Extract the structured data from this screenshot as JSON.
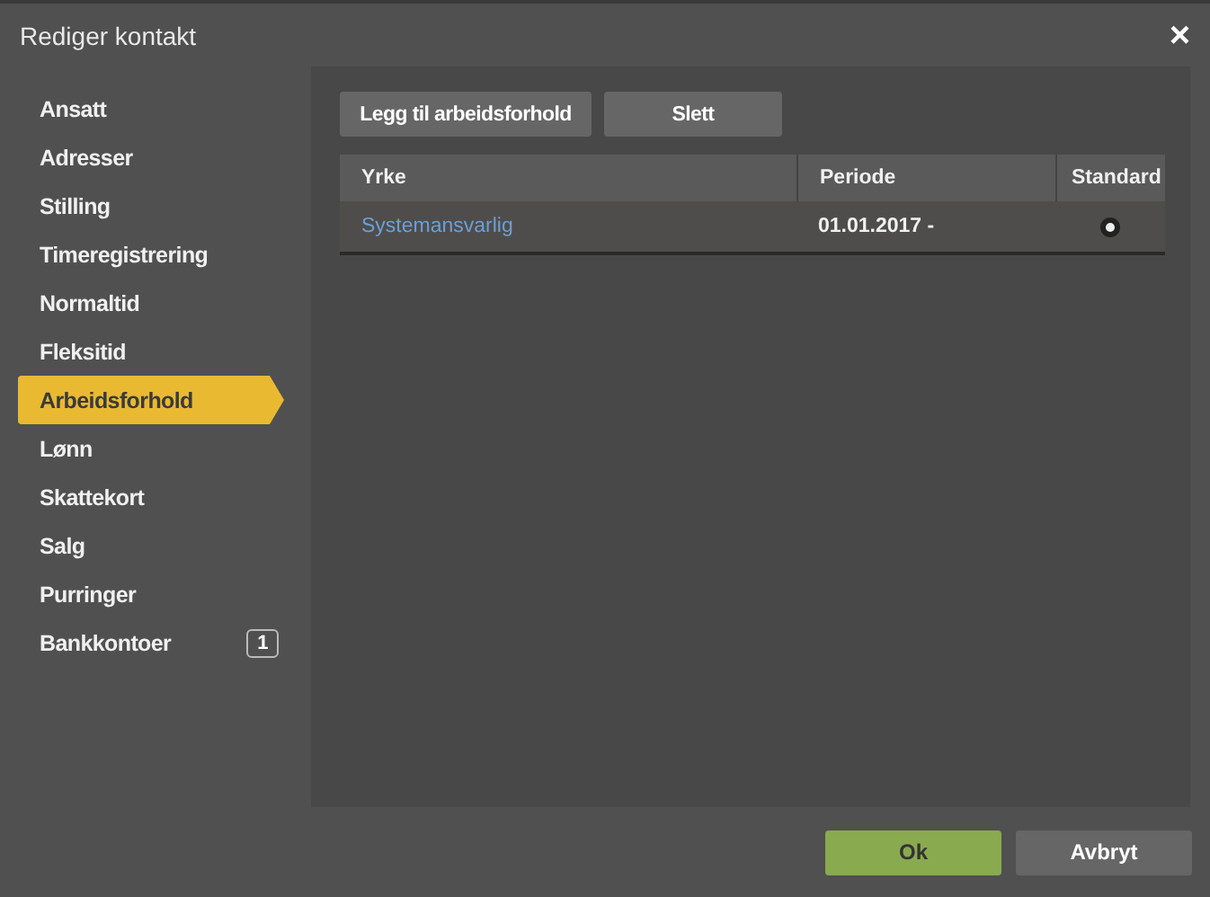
{
  "window": {
    "title": "Rediger kontakt",
    "close": "×"
  },
  "sidebar": {
    "items": [
      {
        "label": "Ansatt",
        "selected": false
      },
      {
        "label": "Adresser",
        "selected": false
      },
      {
        "label": "Stilling",
        "selected": false
      },
      {
        "label": "Timeregistrering",
        "selected": false
      },
      {
        "label": "Normaltid",
        "selected": false
      },
      {
        "label": "Fleksitid",
        "selected": false
      },
      {
        "label": "Arbeidsforhold",
        "selected": true
      },
      {
        "label": "Lønn",
        "selected": false
      },
      {
        "label": "Skattekort",
        "selected": false
      },
      {
        "label": "Salg",
        "selected": false
      },
      {
        "label": "Purringer",
        "selected": false
      },
      {
        "label": "Bankkontoer",
        "selected": false,
        "badge": "1"
      }
    ]
  },
  "toolbar": [
    "Legg til arbeidsforhold",
    "Slett"
  ],
  "table": {
    "columns": [
      "Yrke",
      "Periode",
      "Standard"
    ],
    "rows": [
      {
        "yrke": "Systemansvarlig",
        "periode": "01.01.2017 -",
        "standard": true
      }
    ]
  },
  "footer": {
    "ok": "Ok",
    "cancel": "Avbryt"
  }
}
